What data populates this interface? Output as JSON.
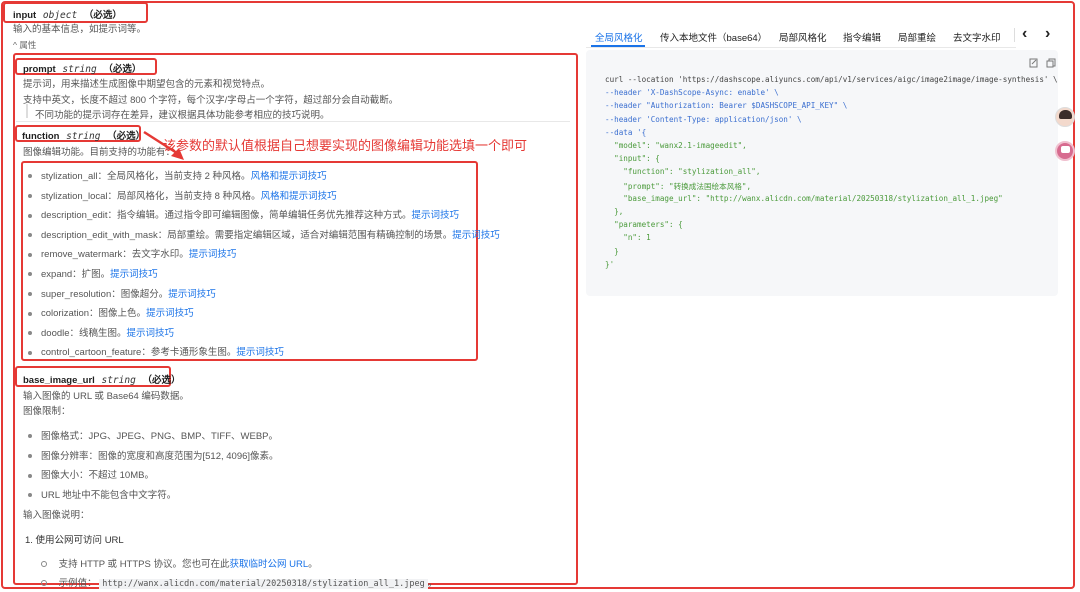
{
  "input": {
    "name": "input",
    "type": "object",
    "req": "（必选）",
    "desc": "输入的基本信息，如提示词等。",
    "attr_toggle": "属性"
  },
  "prompt": {
    "name": "prompt",
    "type": "string",
    "req": "（必选）",
    "lines": [
      "提示词，用来描述生成图像中期望包含的元素和视觉特点。",
      "支持中英文，长度不超过 800 个字符，每个汉字/字母占一个字符，超过部分会自动截断。",
      "不同功能的提示词存在差异，建议根据具体功能参考相应的技巧说明。"
    ]
  },
  "function": {
    "name": "function",
    "type": "string",
    "req": "（必选）",
    "desc": "图像编辑功能。目前支持的功能有：",
    "annotation": "该参数的默认值根据自己想要实现的图像编辑功能选填一个即可",
    "items": [
      {
        "text": "stylization_all：全局风格化，当前支持 2 种风格。",
        "link": "风格和提示词技巧"
      },
      {
        "text": "stylization_local：局部风格化，当前支持 8 种风格。",
        "link": "风格和提示词技巧"
      },
      {
        "text": "description_edit：指令编辑。通过指令即可编辑图像，简单编辑任务优先推荐这种方式。",
        "link": "提示词技巧"
      },
      {
        "text": "description_edit_with_mask：局部重绘。需要指定编辑区域，适合对编辑范围有精确控制的场景。",
        "link": "提示词技巧"
      },
      {
        "text": "remove_watermark：去文字水印。",
        "link": "提示词技巧"
      },
      {
        "text": "expand：扩图。",
        "link": "提示词技巧"
      },
      {
        "text": "super_resolution：图像超分。",
        "link": "提示词技巧"
      },
      {
        "text": "colorization：图像上色。",
        "link": "提示词技巧"
      },
      {
        "text": "doodle：线稿生图。",
        "link": "提示词技巧"
      },
      {
        "text": "control_cartoon_feature：参考卡通形象生图。",
        "link": "提示词技巧"
      }
    ]
  },
  "base": {
    "name": "base_image_url",
    "type": "string",
    "req": "（必选）",
    "desc": "输入图像的 URL 或 Base64 编码数据。",
    "limits_title": "图像限制：",
    "limits": [
      "图像格式：JPG、JPEG、PNG、BMP、TIFF、WEBP。",
      "图像分辨率：图像的宽度和高度范围为[512, 4096]像素。",
      "图像大小：不超过 10MB。",
      "URL 地址中不能包含中文字符。"
    ],
    "explain_title": "输入图像说明：",
    "step1": "1.  使用公网可访问 URL",
    "sub1_text": "支持 HTTP 或 HTTPS 协议。您也可在此",
    "sub1_link": "获取临时公网 URL",
    "sub1_end": "。",
    "sub2_label": "示例值：",
    "sub2_value": "http://wanx.alicdn.com/material/20250318/stylization_all_1.jpeg",
    "sub2_end": "。"
  },
  "tabs": [
    "全局风格化",
    "传入本地文件（base64）",
    "局部风格化",
    "指令编辑",
    "局部重绘",
    "去文字水印"
  ],
  "nav": {
    "prev": "‹",
    "next": "›"
  },
  "code_lines": [
    "curl --location 'https://dashscope.aliyuncs.com/api/v1/services/aigc/image2image/image-synthesis' \\",
    "--header 'X-DashScope-Async: enable' \\",
    "--header \"Authorization: Bearer $DASHSCOPE_API_KEY\" \\",
    "--header 'Content-Type: application/json' \\",
    "--data '{",
    "  \"model\": \"wanx2.1-imageedit\",",
    "  \"input\": {",
    "    \"function\": \"stylization_all\",",
    "    \"prompt\": \"转换成法国绘本风格\",",
    "    \"base_image_url\": \"http://wanx.alicdn.com/material/20250318/stylization_all_1.jpeg\"",
    "  },",
    "  \"parameters\": {",
    "    \"n\": 1",
    "  }",
    "}'"
  ],
  "colors": {
    "accent": "#1a73e8",
    "annotation": "#e53935"
  }
}
